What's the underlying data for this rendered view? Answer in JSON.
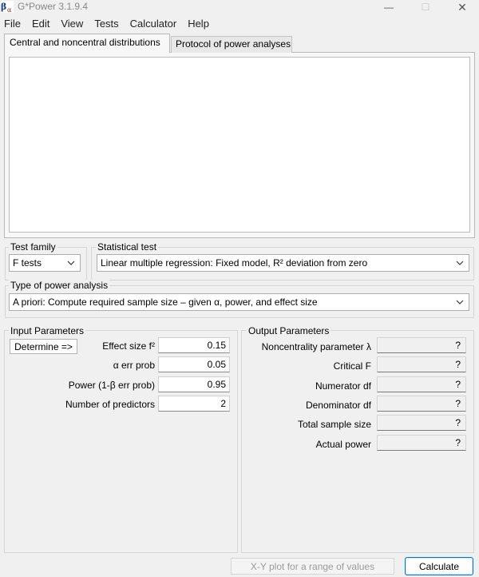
{
  "window": {
    "title": "G*Power 3.1.9.4",
    "minimize_glyph": "—",
    "maximize_glyph": "☐",
    "close_glyph": "✕",
    "icon": "gpower-app-icon"
  },
  "menu": [
    "File",
    "Edit",
    "View",
    "Tests",
    "Calculator",
    "Help"
  ],
  "tabs": {
    "central": "Central and noncentral distributions",
    "protocol": "Protocol of power analyses"
  },
  "test_family": {
    "label": "Test family",
    "value": "F tests"
  },
  "statistical_test": {
    "label": "Statistical test",
    "value": "Linear multiple regression: Fixed model, R² deviation from zero"
  },
  "power_analysis": {
    "label": "Type of power analysis",
    "value": "A priori: Compute required sample size – given α, power, and effect size"
  },
  "input": {
    "title": "Input Parameters",
    "determine_label": "Determine =>",
    "params": [
      {
        "label": "Effect size f²",
        "value": "0.15"
      },
      {
        "label": "α err prob",
        "value": "0.05"
      },
      {
        "label": "Power (1-β err prob)",
        "value": "0.95"
      },
      {
        "label": "Number of predictors",
        "value": "2"
      }
    ]
  },
  "output": {
    "title": "Output Parameters",
    "params": [
      {
        "label": "Noncentrality parameter λ",
        "value": "?"
      },
      {
        "label": "Critical F",
        "value": "?"
      },
      {
        "label": "Numerator df",
        "value": "?"
      },
      {
        "label": "Denominator df",
        "value": "?"
      },
      {
        "label": "Total sample size",
        "value": "?"
      },
      {
        "label": "Actual power",
        "value": "?"
      }
    ]
  },
  "buttons": {
    "xy_plot": "X-Y plot for a range of values",
    "calculate": "Calculate"
  },
  "colors": {
    "accent": "#0078d7",
    "window_bg": "#f0f0f0"
  }
}
